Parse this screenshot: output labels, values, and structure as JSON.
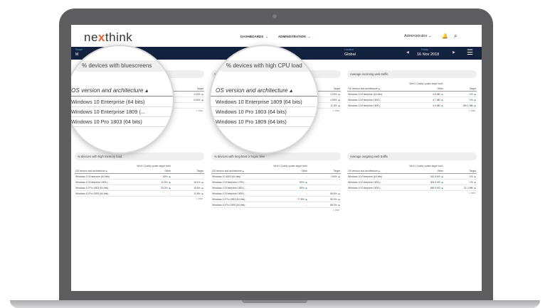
{
  "header": {
    "logo_prefix": "ne",
    "logo_x": "x",
    "logo_suffix": "think",
    "nav": [
      {
        "label": "DASHBOARDS"
      },
      {
        "label": "ADMINISTRATION"
      }
    ],
    "user": "Administrator",
    "chevron": "⌄"
  },
  "filterbar": {
    "left_label": "Scope",
    "left_value": "M",
    "location_label": "Location",
    "location_value": "Global",
    "date_label": "Friday",
    "date_value": "16 Nov 2018"
  },
  "widgets": [
    {
      "title": "% devices with bluescreens",
      "subtitle": "Win10 Quality update target build",
      "col_header": "OS version and architecture ▴",
      "col2": "",
      "col3": "Target",
      "rows": [
        {
          "name": "Windows 10 Enterprise (64 bits)",
          "v2": "",
          "v3": "2.22%"
        },
        {
          "name": "Windows 10 Enterprise 1809 (...",
          "v2": "",
          "v3": "0.00%"
        },
        {
          "name": "Windows 10 Pro 1803 (64 bits)",
          "v2": "",
          "v3": ""
        }
      ],
      "csv": "⇩ CSV"
    },
    {
      "title": "% devices with high CPU load",
      "subtitle": "Win10 Quality update target build",
      "col_header": "OS version and architecture ▴",
      "col2": "",
      "col3": "Target",
      "rows": [
        {
          "name": "Windows 10 Enterprise (64 bits)",
          "v2": "",
          "v3": "2.23%"
        },
        {
          "name": "Windows 10 Pro 1803 (64 bits)",
          "v2": "",
          "v3": "4.55%"
        },
        {
          "name": "Windows 10 Pro 1803 (64 bits)",
          "v2": "",
          "v3": "11.5%"
        }
      ],
      "csv": "⇩ CSV"
    },
    {
      "title": "Average incoming web traffic",
      "subtitle": "Win10 Quality update target build",
      "col_header": "OS version and architecture ▴",
      "col2": "Other",
      "col3": "Target",
      "rows": [
        {
          "name": "Windows 10 Enterprise (64 bits)",
          "v2": "4.8 MB",
          "v3": "0 B"
        },
        {
          "name": "Windows 10 Enterprise 1803 (...",
          "v2": "4.7 MB",
          "v3": "0 B"
        },
        {
          "name": "Windows 10 Enterprise 1809 (...",
          "v2": "4.4 MB",
          "v3": "180.1 MB"
        }
      ],
      "csv": "⇩ CSV"
    },
    {
      "title": "% devices with high memory load",
      "subtitle": "Win10 Quality update target build",
      "col_header": "OS version and architecture ▴",
      "col2": "Other",
      "col3": "Target",
      "rows": [
        {
          "name": "Windows 10 Enterprise (64 bits)",
          "v2": "50%",
          "v3": "-"
        },
        {
          "name": "Windows 10 Enterprise 1809 (...",
          "v2": "12.5%",
          "v3": "16.1%"
        },
        {
          "name": "Windows 10 Pro 1803 (64 bits)",
          "v2": "33.3%",
          "v3": "15.6%"
        },
        {
          "name": "Windows 10 Pro 1809 (64 bits)",
          "v2": "-",
          "v3": "11.8%"
        }
      ],
      "csv": "⇩ CSV"
    },
    {
      "title": "% devices with long boot or logon time",
      "subtitle": "Win10 Quality update target build",
      "col_header": "OS version and architecture ▴",
      "col2": "Other",
      "col3": "Target",
      "rows": [
        {
          "name": "Windows 10 1803 (64 bits)",
          "v2": "-",
          "v3": "100%"
        },
        {
          "name": "Windows 10 Enterprise 1709 (...",
          "v2": "50%",
          "v3": "-"
        },
        {
          "name": "Windows 10 Enterprise 1803 (...",
          "v2": "50%",
          "v3": "-"
        },
        {
          "name": "Windows 10 Enterprise 1809 (...",
          "v2": "-",
          "v3": "56.8%"
        },
        {
          "name": "Windows 10 Pro 1803 (64 bits)",
          "v2": "77.8%",
          "v3": "50.0%"
        },
        {
          "name": "Windows 10 Pro 1809 (64 bits)",
          "v2": "-",
          "v3": "88.2%"
        }
      ],
      "csv": "⇩ CSV"
    },
    {
      "title": "Average outgoing web traffic",
      "subtitle": "Win10 Quality update target build",
      "col_header": "OS version and architecture ▴",
      "col2": "Other",
      "col3": "Target",
      "rows": [
        {
          "name": "Windows 10 Enterprise (64 bits)",
          "v2": "342.5 KB",
          "v3": "0 B"
        },
        {
          "name": "Windows 10 Enterprise 1803 (...",
          "v2": "304.5 KB",
          "v3": "0 B"
        },
        {
          "name": "Windows 10 Enterprise 1809 (...",
          "v2": "656.9 KB",
          "v3": "21.2 MB"
        }
      ],
      "csv": "⇩ CSV"
    }
  ],
  "magnifier_left": {
    "title": "% devices with bluescreens",
    "header": "OS version and architecture ▴",
    "rows": [
      "Windows 10 Enterprise (64 bits)",
      "Windows 10 Enterprise 1809 (...",
      "Windows 10 Pro 1803 (64 bits)"
    ]
  },
  "magnifier_right": {
    "title": "% devices with high CPU load",
    "header": "OS version and architecture ▴",
    "rows": [
      "Windows 10 Enterprise 1809 (64 bits)",
      "Windows 10 Pro 1803 (64 bits)",
      "Windows 10 Pro 1809 (64 bits)"
    ]
  }
}
